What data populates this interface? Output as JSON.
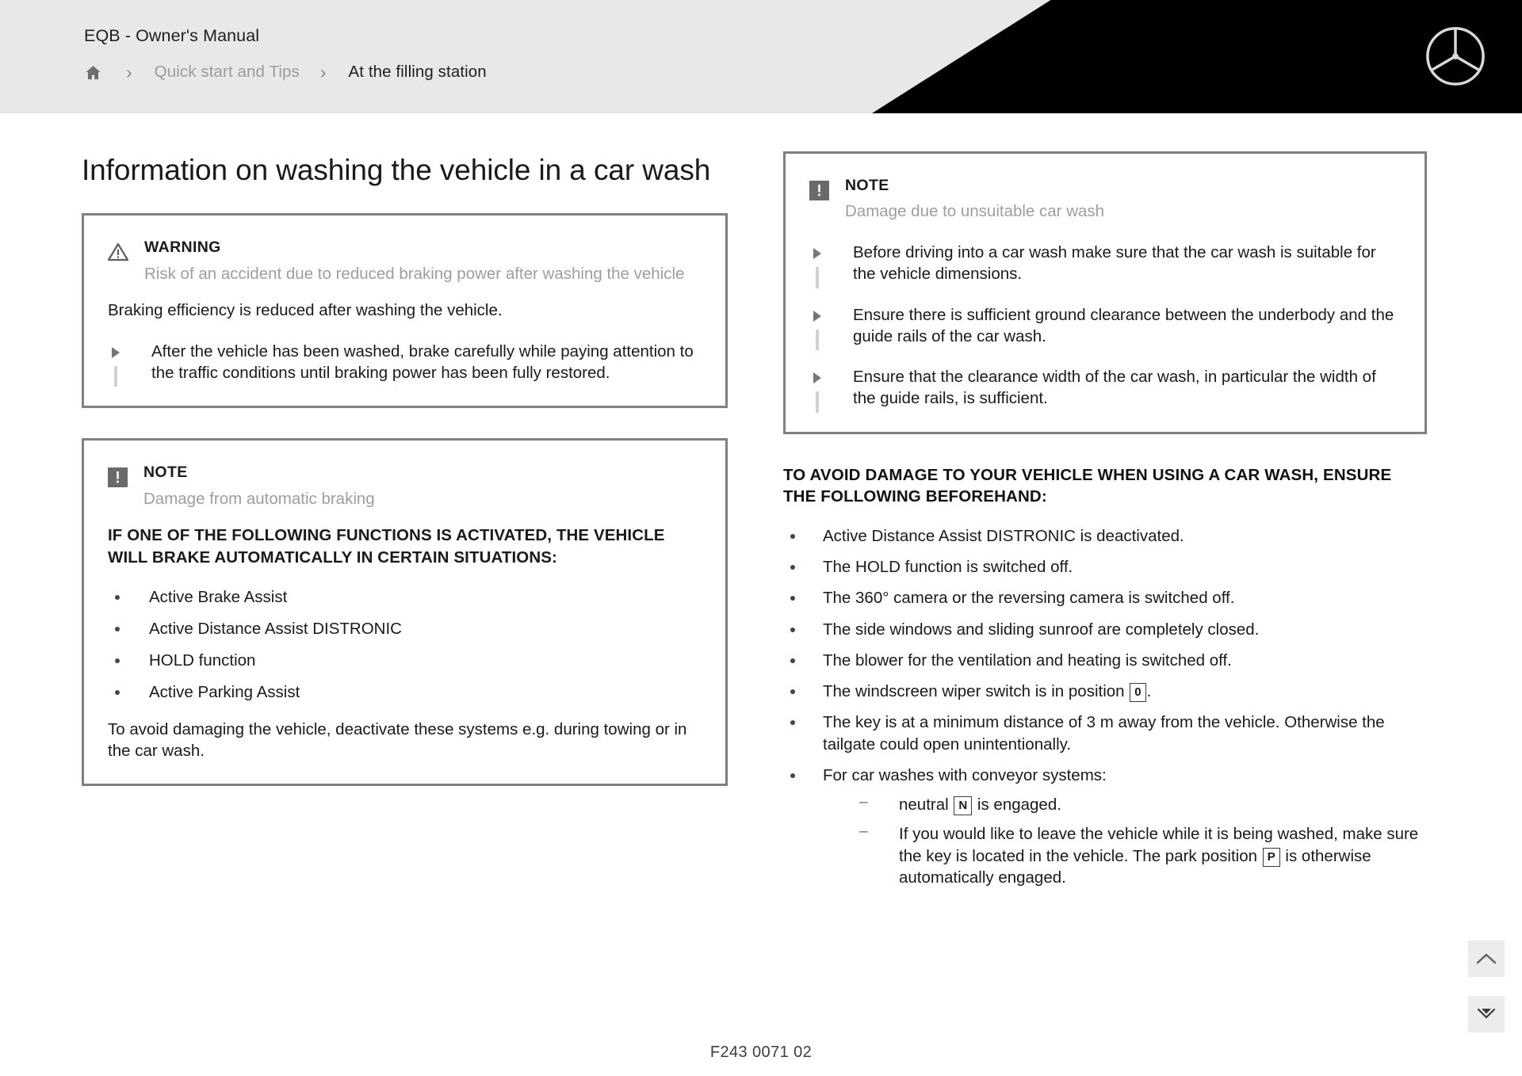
{
  "header": {
    "manual_title": "EQB - Owner's Manual",
    "home_icon": "home-icon",
    "separator": "›",
    "breadcrumb": [
      {
        "label": "Quick start and Tips",
        "state": "muted"
      },
      {
        "label": "At the filling station",
        "state": "current"
      }
    ],
    "logo": "mercedes-star-logo"
  },
  "main": {
    "title": "Information on washing the vehicle in a car wash",
    "left_column": {
      "warning_box": {
        "icon": "warning-triangle-icon",
        "label": "WARNING",
        "subtitle": "Risk of an accident due to reduced braking power after washing the vehicle",
        "body": "Braking efficiency is reduced after washing the vehicle.",
        "action": "After the vehicle has been washed, brake carefully while paying attention to the traffic conditions until braking power has been fully restored."
      },
      "note_box": {
        "icon": "note-exclamation-icon",
        "label": "NOTE",
        "subtitle": "Damage from automatic braking",
        "heading": "IF ONE OF THE FOLLOWING FUNCTIONS IS ACTIVATED, THE VEHICLE WILL BRAKE AUTOMATICALLY IN CERTAIN SITUATIONS:",
        "items": [
          "Active Brake Assist",
          "Active Distance Assist DISTRONIC",
          "HOLD function",
          "Active Parking Assist"
        ],
        "closing": "To avoid damaging the vehicle, deactivate these systems e.g. during towing or in the car wash."
      }
    },
    "right_column": {
      "note_box": {
        "icon": "note-exclamation-icon",
        "label": "NOTE",
        "subtitle": "Damage due to unsuitable car wash",
        "actions": [
          "Before driving into a car wash make sure that the car wash is suitable for the vehicle dimensions.",
          "Ensure there is sufficient ground clearance between the underbody and the guide rails of the car wash.",
          "Ensure that the clearance width of the car wash, in particular the width of the guide rails, is sufficient."
        ]
      },
      "section_heading": "TO AVOID DAMAGE TO YOUR VEHICLE WHEN USING A CAR WASH, ENSURE THE FOLLOWING BEFOREHAND:",
      "items": [
        {
          "text": "Active Distance Assist DISTRONIC is deactivated."
        },
        {
          "text": "The HOLD function is switched off."
        },
        {
          "text": "The 360° camera or the reversing camera is switched off."
        },
        {
          "text": "The side windows and sliding sunroof are completely closed."
        },
        {
          "text": "The blower for the ventilation and heating is switched off."
        },
        {
          "text_before": "The windscreen wiper switch is in position ",
          "glyph": "0",
          "text_after": "."
        },
        {
          "text": "The key is at a minimum distance of 3 m away from the vehicle. Otherwise the tailgate could open unintentionally."
        },
        {
          "text": "For car washes with conveyor systems:",
          "sub_items": [
            {
              "text_before": "neutral ",
              "glyph": "N",
              "text_after": " is engaged."
            },
            {
              "text_before": "If you would like to leave the vehicle while it is being washed, make sure the key is located in the vehicle. The park position ",
              "glyph": "P",
              "text_after": " is otherwise automatically engaged."
            }
          ]
        }
      ]
    }
  },
  "footer": {
    "code": "F243 0071 02"
  },
  "floating_buttons": [
    {
      "name": "scroll-up-button",
      "icon": "chevron-up-icon"
    },
    {
      "name": "collapse-button",
      "icon": "collapse-arrows-icon"
    }
  ],
  "colors": {
    "header_bg": "#e8e8e8",
    "header_black": "#000000",
    "box_border": "#808080",
    "muted_text": "#9e9e9e"
  }
}
